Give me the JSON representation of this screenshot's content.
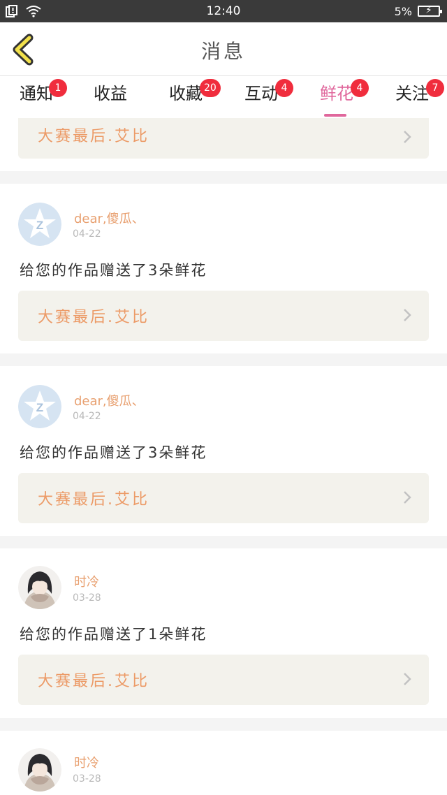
{
  "status_bar": {
    "time": "12:40",
    "battery": "5%"
  },
  "header": {
    "title": "消息"
  },
  "tabs": [
    {
      "label": "通知",
      "badge": "1"
    },
    {
      "label": "收益",
      "badge": ""
    },
    {
      "label": "收藏",
      "badge": "20"
    },
    {
      "label": "互动",
      "badge": "4"
    },
    {
      "label": "鲜花",
      "badge": "4",
      "active": true
    },
    {
      "label": "关注",
      "badge": "7"
    }
  ],
  "top_ref": {
    "title": "大赛最后.艾比"
  },
  "messages": [
    {
      "user": "dear,傻瓜、",
      "date": "04-22",
      "text": "给您的作品赠送了3朵鲜花",
      "ref": "大赛最后.艾比",
      "avatar": "qzone-avatar"
    },
    {
      "user": "dear,傻瓜、",
      "date": "04-22",
      "text": "给您的作品赠送了3朵鲜花",
      "ref": "大赛最后.艾比",
      "avatar": "qzone-avatar"
    },
    {
      "user": "时冷",
      "date": "03-28",
      "text": "给您的作品赠送了1朵鲜花",
      "ref": "大赛最后.艾比",
      "avatar": "anime-avatar"
    },
    {
      "user": "时冷",
      "date": "03-28",
      "text": "",
      "ref": "",
      "avatar": "anime-avatar"
    }
  ],
  "colors": {
    "accent": "#e0679c",
    "badge": "#f02d3d",
    "name": "#e8a070",
    "ref_text": "#ec9a66",
    "ref_bg": "#f3f2ec"
  }
}
